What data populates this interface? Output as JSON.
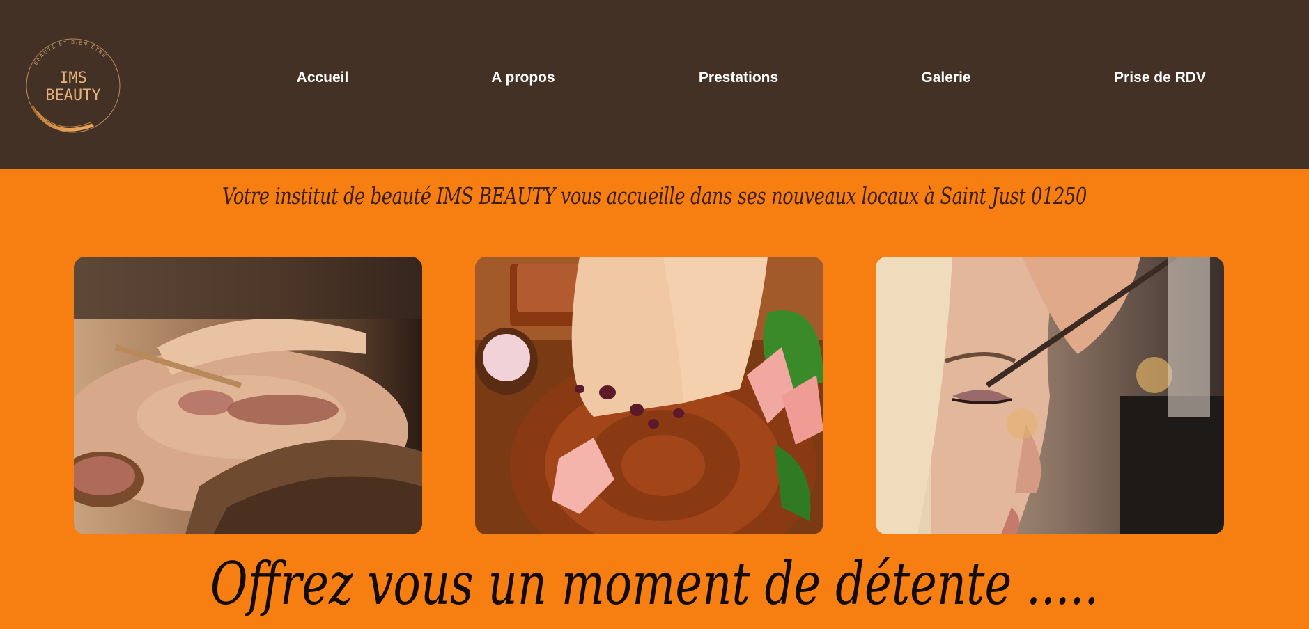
{
  "colors": {
    "header_bg": "#433126",
    "page_bg": "#f77f12",
    "nav_text": "#ffffff",
    "logo_gold": "#d99a4a"
  },
  "logo": {
    "line1": "IMS",
    "line2": "BEAUTY",
    "ring_text": "BEAUTÉ ET BIEN ÊTRE"
  },
  "nav": {
    "items": [
      {
        "label": "Accueil"
      },
      {
        "label": "A propos"
      },
      {
        "label": "Prestations"
      },
      {
        "label": "Galerie"
      },
      {
        "label": "Prise de RDV"
      }
    ]
  },
  "main": {
    "tagline": "Votre institut de beauté IMS BEAUTY vous accueille dans ses nouveaux locaux à Saint Just 01250",
    "gallery": [
      {
        "subject": "facial-mask-photo"
      },
      {
        "subject": "pedicure-photo"
      },
      {
        "subject": "makeup-photo"
      }
    ],
    "headline": "Offrez vous un moment de détente ....."
  }
}
